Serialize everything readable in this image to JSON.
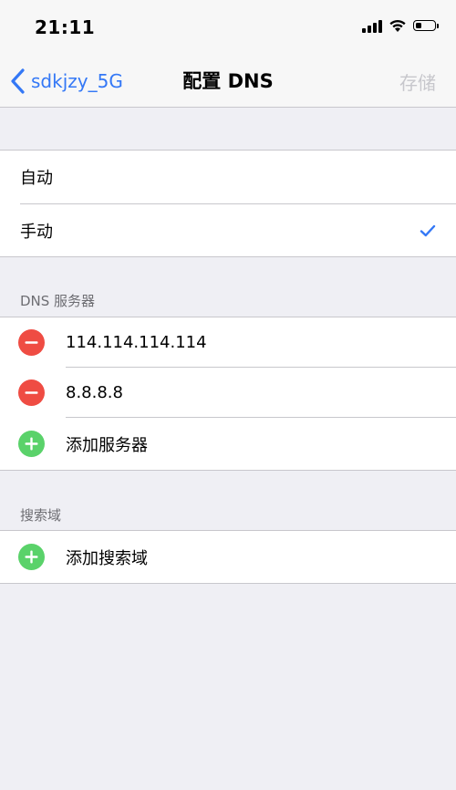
{
  "status_bar": {
    "time": "21:11",
    "battery_level": 0.35
  },
  "nav": {
    "back_label": "sdkjzy_5G",
    "title": "配置 DNS",
    "save_label": "存储"
  },
  "mode_group": {
    "options": [
      {
        "label": "自动",
        "selected": false
      },
      {
        "label": "手动",
        "selected": true
      }
    ]
  },
  "dns_section": {
    "header": "DNS 服务器",
    "servers": [
      "114.114.114.114",
      "8.8.8.8"
    ],
    "add_label": "添加服务器"
  },
  "search_section": {
    "header": "搜索域",
    "add_label": "添加搜索域"
  },
  "colors": {
    "accent": "#3478f6",
    "delete": "#ef4c43",
    "add": "#5ad26a"
  },
  "icons": {
    "back": "chevron-left-icon",
    "check": "checkmark-icon",
    "delete": "minus-circle-icon",
    "add": "plus-circle-icon",
    "wifi": "wifi-icon",
    "signal": "cellular-signal-icon",
    "battery": "battery-icon"
  }
}
